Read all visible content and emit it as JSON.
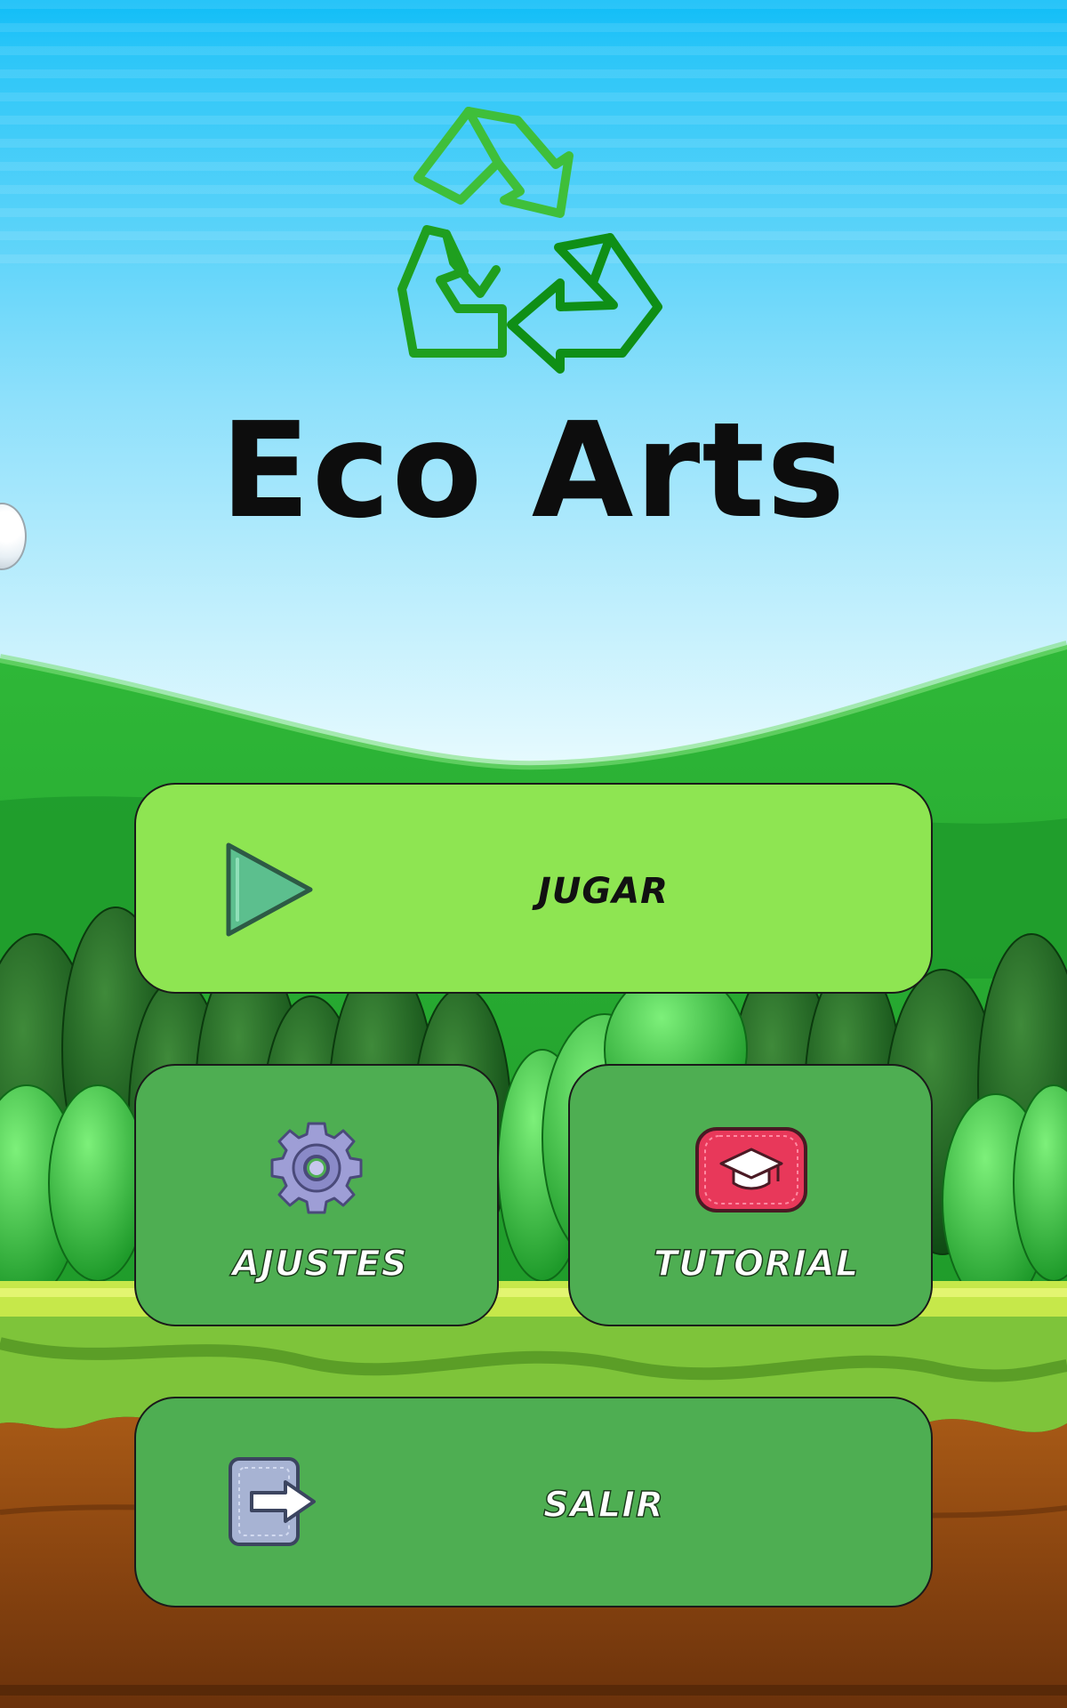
{
  "app": {
    "title": "Eco Arts"
  },
  "menu": {
    "play": {
      "label": "JUGAR",
      "icon": "play-icon",
      "color": "#8ee552"
    },
    "settings": {
      "label": "AJUSTES",
      "icon": "gear-icon",
      "color": "#4eae52"
    },
    "tutorial": {
      "label": "TUTORIAL",
      "icon": "graduation-cap-icon",
      "color": "#4eae52"
    },
    "exit": {
      "label": "SALIR",
      "icon": "exit-door-icon",
      "color": "#4eae52"
    }
  },
  "logo": {
    "icon": "recycle-icon",
    "color": "#1aa31a"
  }
}
